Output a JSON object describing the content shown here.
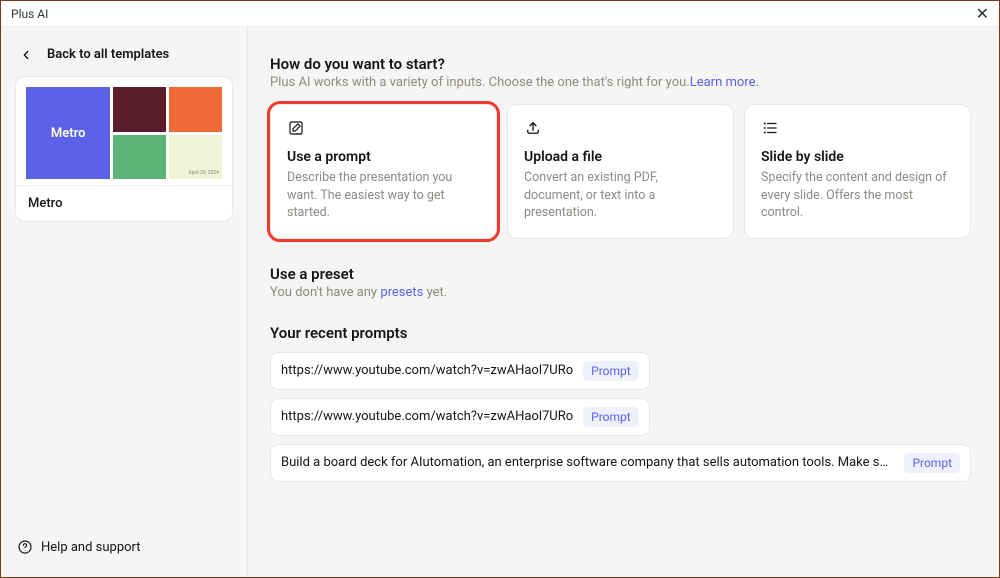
{
  "window": {
    "title": "Plus AI"
  },
  "sidebar": {
    "back_label": "Back to all templates",
    "template": {
      "name": "Metro",
      "thumb_label": "Metro",
      "thumb_date": "April 25, 2024"
    },
    "help_label": "Help and support"
  },
  "start": {
    "heading": "How do you want to start?",
    "subtext_prefix": "Plus AI works with a variety of inputs. Choose the one that's right for you.",
    "learn_more": "Learn more.",
    "cards": [
      {
        "icon": "edit-icon",
        "title": "Use a prompt",
        "desc": "Describe the presentation you want. The easiest way to get started.",
        "highlight": true
      },
      {
        "icon": "upload-icon",
        "title": "Upload a file",
        "desc": "Convert an existing PDF, document, or text into a presentation.",
        "highlight": false
      },
      {
        "icon": "list-icon",
        "title": "Slide by slide",
        "desc": "Specify the content and design of every slide. Offers the most control.",
        "highlight": false
      }
    ]
  },
  "presets": {
    "heading": "Use a preset",
    "text_prefix": "You don't have any ",
    "link_text": "presets",
    "text_suffix": " yet."
  },
  "recent": {
    "heading": "Your recent prompts",
    "badge_label": "Prompt",
    "items": [
      {
        "text": "https://www.youtube.com/watch?v=zwAHaol7URo",
        "long": false
      },
      {
        "text": "https://www.youtube.com/watch?v=zwAHaol7URo",
        "long": false
      },
      {
        "text": "Build a board deck for AIutomation, an enterprise software company that sells automation tools. Make sure to start with a C…",
        "long": true
      }
    ]
  }
}
